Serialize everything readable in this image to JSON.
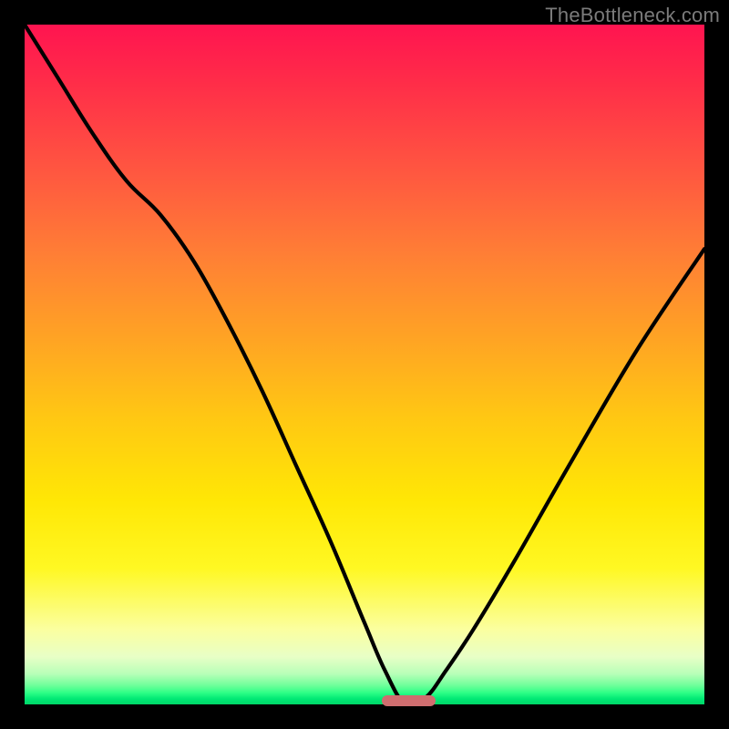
{
  "watermark": "TheBottleneck.com",
  "colors": {
    "frame": "#000000",
    "curve": "#000000",
    "marker": "#cf6d6f"
  },
  "chart_data": {
    "type": "line",
    "title": "",
    "xlabel": "",
    "ylabel": "",
    "xlim": [
      0,
      100
    ],
    "ylim": [
      0,
      100
    ],
    "grid": false,
    "legend": false,
    "note": "V-shaped bottleneck curve on a heat-gradient background; minimum sits near x≈56 at y≈0. Marker pill indicates the optimum region.",
    "series": [
      {
        "name": "bottleneck_curve",
        "x": [
          0,
          5,
          10,
          15,
          20,
          25,
          30,
          35,
          40,
          45,
          50,
          53,
          56,
          59,
          62,
          66,
          72,
          80,
          90,
          100
        ],
        "y": [
          100,
          92,
          84,
          77,
          72,
          65,
          56,
          46,
          35,
          24,
          12,
          5,
          0,
          1,
          5,
          11,
          21,
          35,
          52,
          67
        ]
      }
    ],
    "marker": {
      "x_start": 52.5,
      "x_end": 60.5,
      "y": 0.5
    }
  }
}
